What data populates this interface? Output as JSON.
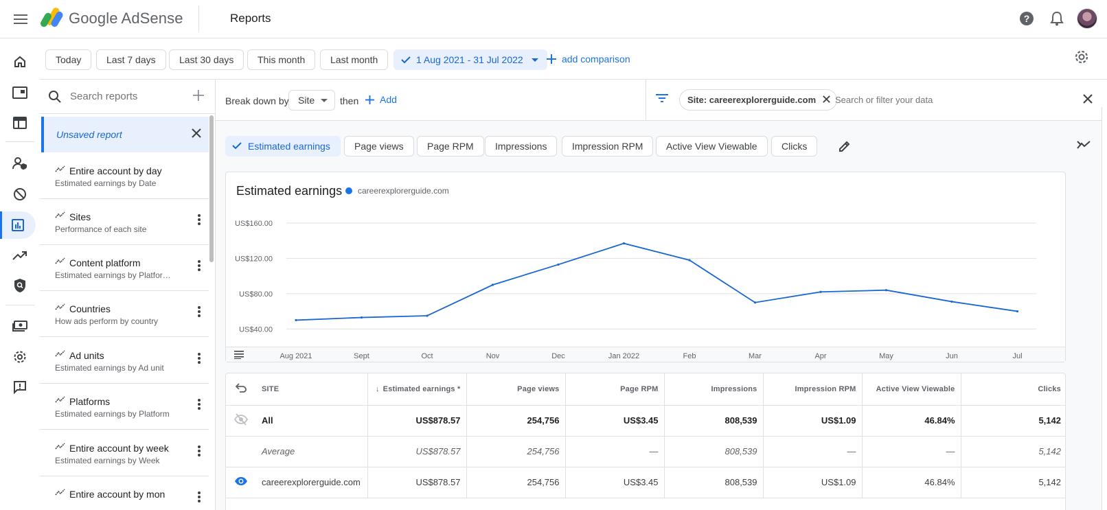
{
  "app": {
    "brand": "Google AdSense",
    "page_title": "Reports"
  },
  "date_range": {
    "chips": [
      "Today",
      "Last 7 days",
      "Last 30 days",
      "This month",
      "Last month"
    ],
    "selected": "1 Aug 2021 - 31 Jul 2022",
    "add_comparison": "add comparison"
  },
  "reports_panel": {
    "search_placeholder": "Search reports",
    "unsaved": "Unsaved report",
    "items": [
      {
        "title": "Entire account by day",
        "subtitle": "Estimated earnings by Date"
      },
      {
        "title": "Sites",
        "subtitle": "Performance of each site"
      },
      {
        "title": "Content platform",
        "subtitle": "Estimated earnings by Platform…"
      },
      {
        "title": "Countries",
        "subtitle": "How ads perform by country"
      },
      {
        "title": "Ad units",
        "subtitle": "Estimated earnings by Ad unit"
      },
      {
        "title": "Platforms",
        "subtitle": "Estimated earnings by Platform"
      },
      {
        "title": "Entire account by week",
        "subtitle": "Estimated earnings by Week"
      },
      {
        "title": "Entire account by mon",
        "subtitle": ""
      }
    ]
  },
  "breakdown": {
    "label": "Break down by",
    "dimension": "Site",
    "then": "then",
    "add": "Add"
  },
  "filter": {
    "chip": "Site: careerexplorerguide.com",
    "search_placeholder": "Search or filter your data"
  },
  "metrics": [
    "Estimated earnings",
    "Page views",
    "Page RPM",
    "Impressions",
    "Impression RPM",
    "Active View Viewable",
    "Clicks"
  ],
  "chart_data": {
    "type": "line",
    "title": "Estimated earnings",
    "series": [
      {
        "name": "careerexplorerguide.com",
        "color": "#1967d2",
        "values": [
          50,
          53,
          55,
          90,
          113,
          137,
          118,
          70,
          82,
          84,
          71,
          60
        ]
      }
    ],
    "categories": [
      "Aug 2021",
      "Sept",
      "Oct",
      "Nov",
      "Dec",
      "Jan 2022",
      "Feb",
      "Mar",
      "Apr",
      "May",
      "Jun",
      "Jul"
    ],
    "y_ticks": [
      "US$40.00",
      "US$80.00",
      "US$120.00",
      "US$160.00"
    ],
    "ylim": [
      20,
      160
    ],
    "grid": true
  },
  "table": {
    "headers": [
      "SITE",
      "Estimated earnings *",
      "Page views",
      "Page RPM",
      "Impressions",
      "Impression RPM",
      "Active View Viewable",
      "Clicks"
    ],
    "rows": [
      {
        "label": "All",
        "cells": [
          "US$878.57",
          "254,756",
          "US$3.45",
          "808,539",
          "US$1.09",
          "46.84%",
          "5,142"
        ]
      },
      {
        "label": "Average",
        "cells": [
          "US$878.57",
          "254,756",
          "—",
          "808,539",
          "—",
          "—",
          "5,142"
        ]
      },
      {
        "label": "careerexplorerguide.com",
        "cells": [
          "US$878.57",
          "254,756",
          "US$3.45",
          "808,539",
          "US$1.09",
          "46.84%",
          "5,142"
        ]
      }
    ]
  },
  "colors": {
    "accent": "#1a73e8",
    "selected_bg": "#e8f0fe",
    "line": "#1967d2"
  }
}
